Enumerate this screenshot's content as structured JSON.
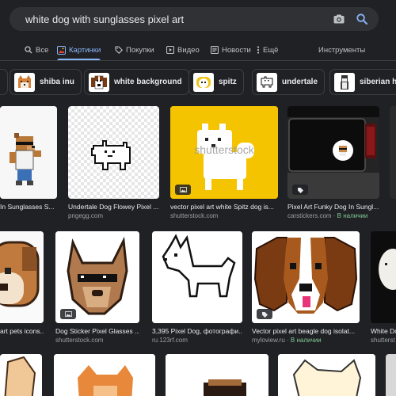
{
  "search": {
    "query": "white dog with sunglasses pixel art",
    "camera_icon": "camera-icon",
    "search_icon": "search-icon"
  },
  "tabs": {
    "all": "Все",
    "images": "Картинки",
    "shopping": "Покупки",
    "video": "Видео",
    "news": "Новости",
    "more": "Ещё",
    "tools": "Инструменты",
    "accent": "#8ab4f8"
  },
  "chips": [
    {
      "label": ""
    },
    {
      "label": "shiba inu"
    },
    {
      "label": "white background"
    },
    {
      "label": "spitz"
    },
    {
      "label": "undertale"
    },
    {
      "label": "siberian hu"
    }
  ],
  "results": {
    "row1": [
      {
        "title": "In Sunglasses S...",
        "source": "",
        "stock": ""
      },
      {
        "title": "Undertale Dog Flowey Pixel ...",
        "source": "pngegg.com",
        "stock": ""
      },
      {
        "title": "vector pixel art white Spitz dog is...",
        "source": "shutterstock.com",
        "stock": "",
        "watermark": "shutterstock"
      },
      {
        "title": "Pixel Art Funky Dog In Sungl...",
        "source": "carstickers.com",
        "stock": "В наличии"
      },
      {
        "title": "",
        "source": "",
        "stock": ""
      }
    ],
    "row2": [
      {
        "title": "art pets icons...",
        "source": "",
        "stock": ""
      },
      {
        "title": "Dog Sticker Pixel Glasses ...",
        "source": "shutterstock.com",
        "stock": ""
      },
      {
        "title": "3,395 Pixel Dog, фотографи...",
        "source": "ru.123rf.com",
        "stock": ""
      },
      {
        "title": "Vector pixel art beagle dog isolat...",
        "source": "myloview.ru",
        "stock": "В наличии"
      },
      {
        "title": "White Do",
        "source": "shutterst",
        "stock": ""
      }
    ]
  }
}
